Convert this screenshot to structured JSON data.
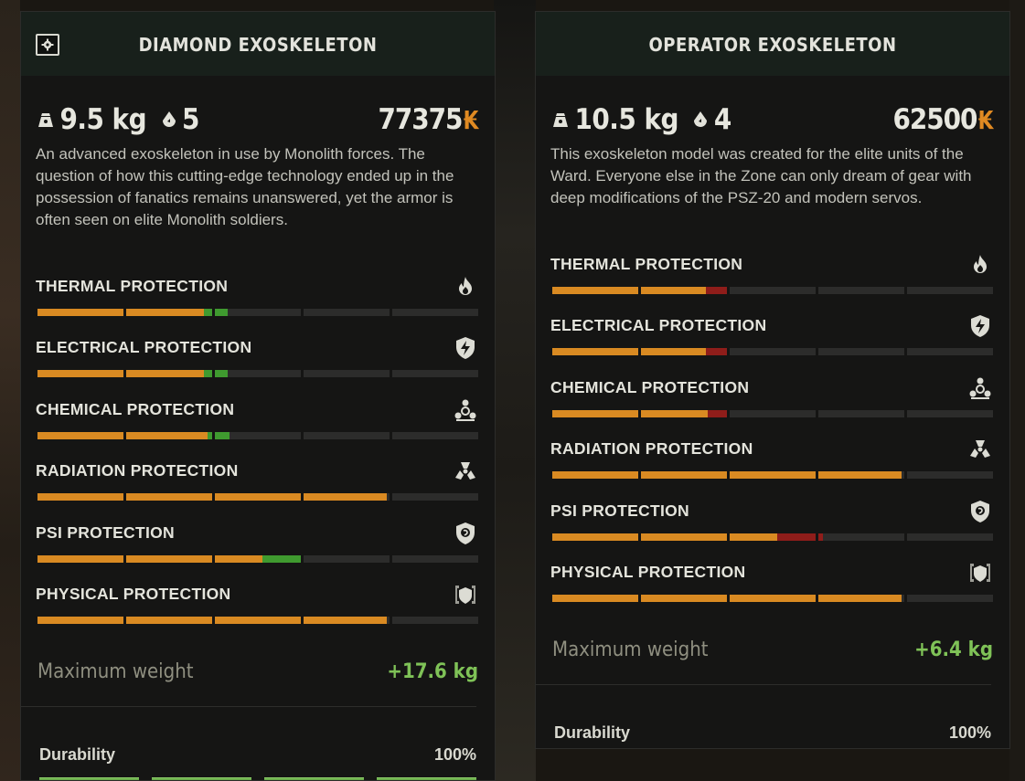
{
  "colors": {
    "orange": "#d98a22",
    "green": "#3f9a2f",
    "red": "#8f1d1a",
    "track": "#2c2c2b",
    "price_icon": "#e08a22",
    "weight_green": "#7fc257"
  },
  "left": {
    "title": "DIAMOND EXOSKELETON",
    "weight": "9.5 kg",
    "slots": "5",
    "price": "77375",
    "description": "An advanced exoskeleton in use by Monolith forces. The question of how this cutting-edge technology ended up in the possession of fanatics remains unanswered, yet the armor is often seen on elite Monolith soldiers.",
    "protections": [
      {
        "label": "THERMAL PROTECTION",
        "icon": "flame-icon",
        "value": 1.9,
        "bonus": 0.25,
        "bonus_type": "green"
      },
      {
        "label": "ELECTRICAL PROTECTION",
        "icon": "lightning-shield-icon",
        "value": 1.9,
        "bonus": 0.25,
        "bonus_type": "green"
      },
      {
        "label": "CHEMICAL PROTECTION",
        "icon": "biohazard-icon",
        "value": 1.95,
        "bonus": 0.22,
        "bonus_type": "green"
      },
      {
        "label": "RADIATION PROTECTION",
        "icon": "radiation-icon",
        "value": 3.97,
        "bonus": 0,
        "bonus_type": "green"
      },
      {
        "label": "PSI PROTECTION",
        "icon": "psi-shield-icon",
        "value": 2.55,
        "bonus": 0.45,
        "bonus_type": "green"
      },
      {
        "label": "PHYSICAL PROTECTION",
        "icon": "armor-icon",
        "value": 3.97,
        "bonus": 0,
        "bonus_type": "green"
      }
    ],
    "max_weight_label": "Maximum weight",
    "max_weight_value": "+17.6 kg",
    "durability_label": "Durability",
    "durability_value": "100%"
  },
  "right": {
    "title": "OPERATOR EXOSKELETON",
    "weight": "10.5 kg",
    "slots": "4",
    "price": "62500",
    "description": "This exoskeleton model was created for the elite units of the Ward.  Everyone else in the Zone can only dream of gear with deep modifications of the PSZ-20 and modern servos.",
    "protections": [
      {
        "label": "THERMAL PROTECTION",
        "icon": "flame-icon",
        "value": 1.75,
        "bonus": 0.25,
        "bonus_type": "red"
      },
      {
        "label": "ELECTRICAL PROTECTION",
        "icon": "lightning-shield-icon",
        "value": 1.75,
        "bonus": 0.25,
        "bonus_type": "red"
      },
      {
        "label": "CHEMICAL PROTECTION",
        "icon": "biohazard-icon",
        "value": 1.78,
        "bonus": 0.22,
        "bonus_type": "red"
      },
      {
        "label": "RADIATION PROTECTION",
        "icon": "radiation-icon",
        "value": 3.97,
        "bonus": 0,
        "bonus_type": "red"
      },
      {
        "label": "PSI PROTECTION",
        "icon": "psi-shield-icon",
        "value": 2.55,
        "bonus": 0.5,
        "bonus_type": "red"
      },
      {
        "label": "PHYSICAL PROTECTION",
        "icon": "armor-icon",
        "value": 3.97,
        "bonus": 0,
        "bonus_type": "red"
      }
    ],
    "max_weight_label": "Maximum weight",
    "max_weight_value": "+6.4 kg",
    "durability_label": "Durability",
    "durability_value": "100%"
  },
  "price_currency_glyph": "₭"
}
